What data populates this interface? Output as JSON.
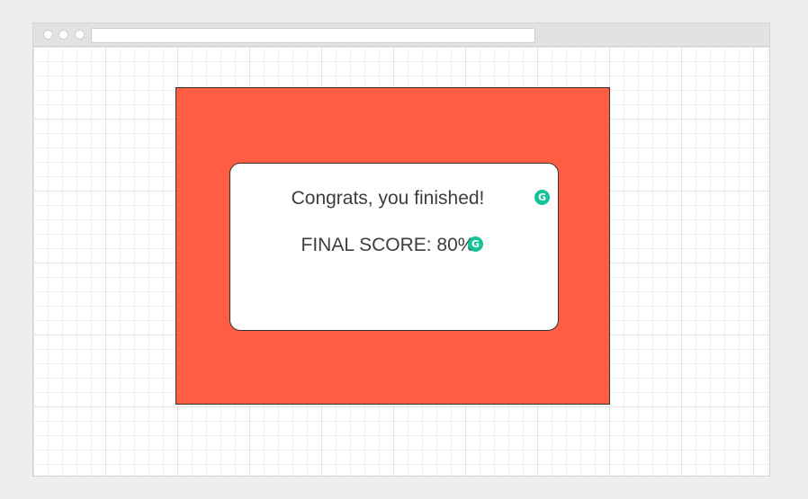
{
  "card": {
    "congrats_text": "Congrats, you finished!",
    "score_text": "FINAL SCORE: 80%"
  },
  "badges": {
    "letter": "G",
    "color": "#15c39a",
    "icon": "grammarly-icon"
  },
  "colors": {
    "stage_background": "#ff5e43",
    "card_background": "#ffffff",
    "text": "#3d3d3d"
  }
}
